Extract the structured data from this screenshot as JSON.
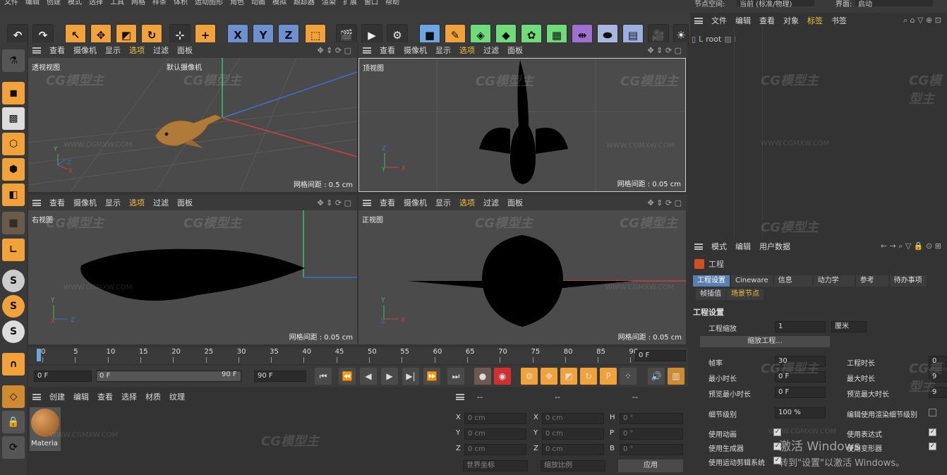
{
  "menu": [
    "文件",
    "编辑",
    "创建",
    "模式",
    "选择",
    "工具",
    "网格",
    "样条",
    "体积",
    "运动图形",
    "角色",
    "动画",
    "模拟",
    "跟踪器",
    "渲染",
    "扩展",
    "窗口",
    "帮助"
  ],
  "top_right": {
    "node_space_label": "节点空间:",
    "node_space_value": "当前 (标准/物理)",
    "interface_label": "界面:",
    "interface_value": "启动"
  },
  "toolbar": {
    "x_label": "X",
    "y_label": "Y",
    "z_label": "Z"
  },
  "viewport_menu": [
    "查看",
    "摄像机",
    "显示",
    "选项",
    "过滤",
    "面板"
  ],
  "viewports": {
    "perspective": {
      "label": "透视视图",
      "camera": "默认摄像机",
      "grid": "网格间距 : 0.5 cm"
    },
    "top": {
      "label": "顶视图",
      "grid": "网格间距 : 0.05 cm"
    },
    "right": {
      "label": "右视图",
      "grid": "网格间距 : 0.05 cm"
    },
    "front": {
      "label": "正视图",
      "grid": "网格间距 : 0.05 cm"
    }
  },
  "timeline": {
    "ticks": [
      "0",
      "5",
      "10",
      "15",
      "20",
      "25",
      "30",
      "35",
      "40",
      "45",
      "50",
      "55",
      "60",
      "65",
      "70",
      "75",
      "80",
      "85",
      "90"
    ],
    "current": "0 F"
  },
  "frame_fields": {
    "start": "0 F",
    "min": "0 F",
    "max": "90 F",
    "end": "90 F"
  },
  "material_menu": [
    "创建",
    "编辑",
    "查看",
    "选择",
    "材质",
    "纹理"
  ],
  "material": {
    "name": "Materia"
  },
  "coords": {
    "rows": [
      {
        "a": "X",
        "av": "0 cm",
        "b": "X",
        "bv": "0 cm",
        "c": "H",
        "cv": "0 °"
      },
      {
        "a": "Y",
        "av": "0 cm",
        "b": "Y",
        "bv": "0 cm",
        "c": "P",
        "cv": "0 °"
      },
      {
        "a": "Z",
        "av": "0 cm",
        "b": "Z",
        "bv": "0 cm",
        "c": "B",
        "cv": "0 °"
      }
    ],
    "dash1": "--",
    "dash2": "--",
    "dash3": "--",
    "world": "世界坐标",
    "scale": "缩放比例",
    "apply": "应用"
  },
  "object_manager": {
    "menu": [
      "文件",
      "编辑",
      "查看",
      "对象",
      "标签",
      "书签"
    ],
    "root": "root"
  },
  "attributes": {
    "menu": [
      "模式",
      "编辑",
      "用户数据"
    ],
    "title": "工程",
    "tabs": [
      "工程设置",
      "Cineware",
      "信息",
      "动力学",
      "参考",
      "待办事项"
    ],
    "subtabs": [
      "帧插值",
      "场景节点"
    ],
    "section": "工程设置",
    "scale_label": "工程缩放",
    "scale_value": "1",
    "scale_unit": "厘米",
    "scale_button": "缩放工程...",
    "fps_label": "帧率",
    "fps_value": "30",
    "duration_label": "工程时长",
    "duration_value": "0",
    "min_label": "最小时长",
    "min_value": "0 F",
    "max_label": "最大时长",
    "max_value": "9",
    "pmin_label": "预览最小时长",
    "pmin_value": "0 F",
    "pmax_label": "预览最大时长",
    "pmax_value": "9",
    "lod_label": "细节级别",
    "lod_value": "100 %",
    "render_lod_label": "编辑使用渲染细节级别",
    "anim_label": "使用动画",
    "expr_label": "使用表达式",
    "gen_label": "使用生成器",
    "deform_label": "使用变形器",
    "motion_label": "使用运动剪辑系统"
  },
  "activation": {
    "line1": "激活 Windows",
    "line2": "转到\"设置\"以激活 Windows。"
  },
  "watermark": {
    "logo": "CG模型主",
    "url": "WWW.CGMXW.COM"
  }
}
